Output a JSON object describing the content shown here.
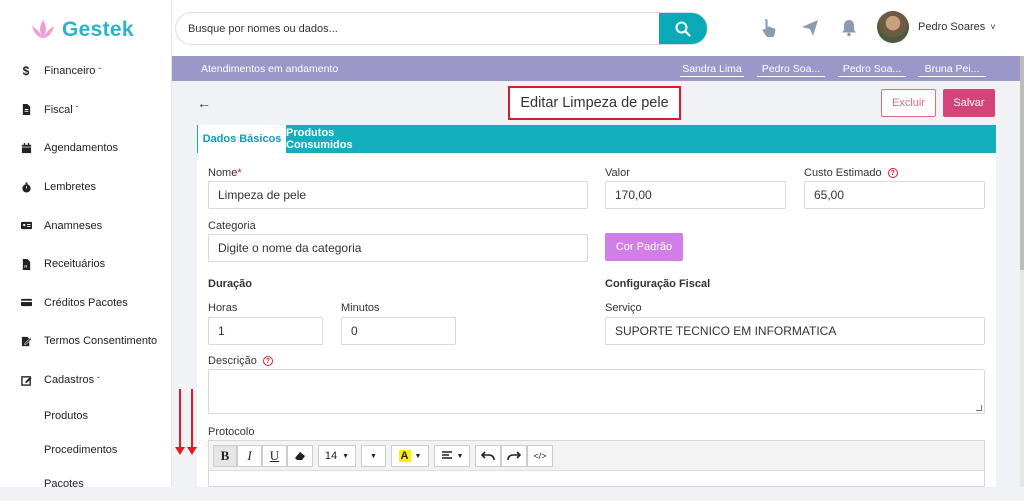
{
  "app": {
    "brand": "Gestek"
  },
  "sidebar": {
    "items": [
      {
        "label": "Financeiro",
        "icon": "dollar-icon",
        "chevron": true
      },
      {
        "label": "Fiscal",
        "icon": "file-icon",
        "chevron": true
      },
      {
        "label": "Agendamentos",
        "icon": "calendar-icon",
        "chevron": false
      },
      {
        "label": "Lembretes",
        "icon": "stopwatch-icon",
        "chevron": false
      },
      {
        "label": "Anamneses",
        "icon": "id-card-icon",
        "chevron": false
      },
      {
        "label": "Receituários",
        "icon": "prescription-icon",
        "chevron": false
      },
      {
        "label": "Créditos Pacotes",
        "icon": "credit-card-icon",
        "chevron": false
      },
      {
        "label": "Termos Consentimento",
        "icon": "signature-icon",
        "chevron": false
      },
      {
        "label": "Cadastros",
        "icon": "edit-icon",
        "chevron": true
      }
    ],
    "subitems": [
      "Produtos",
      "Procedimentos",
      "Pacotes"
    ]
  },
  "header": {
    "search_placeholder": "Busque por nomes ou dados...",
    "user_name": "Pedro Soares",
    "chevron": "˅"
  },
  "attendance": {
    "label": "Atendimentos em andamento",
    "tabs": [
      "Sandra Lima",
      "Pedro Soa...",
      "Pedro Soa...",
      "Bruna Pei..."
    ]
  },
  "page": {
    "back": "←",
    "title": "Editar Limpeza de pele",
    "delete_label": "Excluir",
    "save_label": "Salvar"
  },
  "tabs": {
    "basic": "Dados Básicos",
    "products": "Produtos Consumidos"
  },
  "form": {
    "nome_label": "Nome",
    "nome_required": "*",
    "nome_value": "Limpeza de pele",
    "valor_label": "Valor",
    "valor_value": "170,00",
    "custo_label": "Custo Estimado",
    "custo_value": "65,00",
    "categoria_label": "Categoria",
    "categoria_placeholder": "Digite o nome da categoria",
    "cor_button": "Cor Padrão",
    "duracao_title": "Duração",
    "horas_label": "Horas",
    "horas_value": "1",
    "minutos_label": "Minutos",
    "minutos_value": "0",
    "fiscal_title": "Configuração Fiscal",
    "servico_label": "Serviço",
    "servico_value": "SUPORTE TECNICO EM INFORMATICA",
    "descricao_label": "Descrição",
    "protocolo_label": "Protocolo",
    "help": "?"
  },
  "editor": {
    "bold": "B",
    "italic": "I",
    "underline": "U",
    "font_size": "14",
    "highlight": "A",
    "code": "</>"
  },
  "colors": {
    "accent": "#15aebd",
    "danger": "#e1182c",
    "save": "#d3457a",
    "cor_padrao": "#d27ee9",
    "attendance_bar": "#9b98c9"
  }
}
